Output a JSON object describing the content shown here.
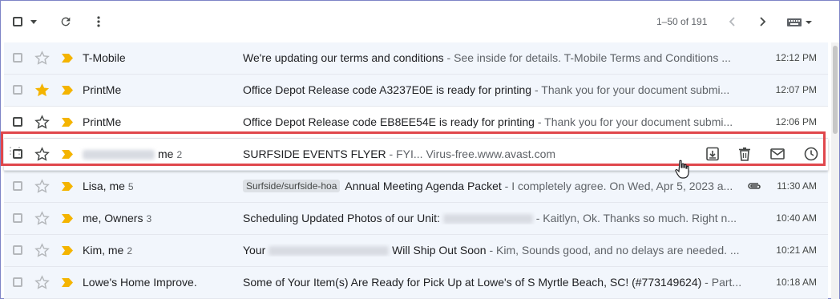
{
  "toolbar": {
    "pagination": "1–50 of 191",
    "icons": [
      "select-all-checkbox",
      "dropdown-caret",
      "refresh-icon",
      "more-vert-icon",
      "chevron-left-icon",
      "chevron-right-icon",
      "keyboard-icon"
    ]
  },
  "colors": {
    "important": "#f4b400",
    "star": "#f4b400",
    "highlight": "#e0474c"
  },
  "emails": [
    {
      "sender": "T-Mobile",
      "count": "",
      "label": "",
      "subject": "We're updating our terms and conditions",
      "snippet": " - See inside for details. T-Mobile Terms and Conditions ...",
      "time": "12:12 PM",
      "starred": false,
      "unread": false,
      "attachment": false
    },
    {
      "sender": "PrintMe",
      "count": "",
      "label": "",
      "subject": "Office Depot Release code A3237E0E is ready for printing",
      "snippet": " - Thank you for your document submi...",
      "time": "12:07 PM",
      "starred": true,
      "unread": false,
      "attachment": false
    },
    {
      "sender": "PrintMe",
      "count": "",
      "label": "",
      "subject": "Office Depot Release code EB8EE54E is ready for printing",
      "snippet": " - Thank you for your document submi...",
      "time": "12:06 PM",
      "starred": false,
      "unread": true,
      "attachment": false
    },
    {
      "sender": "me",
      "count": "2",
      "label": "",
      "subject": "SURFSIDE EVENTS FLYER",
      "snippet": " - FYI... Virus-free.www.avast.com",
      "time": "",
      "starred": false,
      "unread": true,
      "attachment": false,
      "hovered": true
    },
    {
      "sender": "Lisa, me",
      "count": "5",
      "label": "Surfside/surfside-hoa",
      "subject": "Annual Meeting Agenda Packet",
      "snippet": " - I completely agree. On Wed, Apr 5, 2023 a...",
      "time": "11:30 AM",
      "starred": false,
      "unread": false,
      "attachment": true
    },
    {
      "sender": "me, Owners",
      "count": "3",
      "label": "",
      "subject": "Scheduling Updated Photos of our Unit: ",
      "snippet": " - Kaitlyn, Ok. Thanks so much. Right n...",
      "time": "10:40 AM",
      "starred": false,
      "unread": false,
      "attachment": false
    },
    {
      "sender": "Kim, me",
      "count": "2",
      "label": "",
      "subject": "Your ",
      "subject2": " Will Ship Out Soon",
      "snippet": " - Kim, Sounds good, and no delays are needed. ...",
      "time": "10:21 AM",
      "starred": false,
      "unread": false,
      "attachment": false
    },
    {
      "sender": "Lowe's Home Improve.",
      "count": "",
      "label": "",
      "subject": "Some of Your Item(s) Are Ready for Pick Up at Lowe's of S Myrtle Beach, SC! (#773149624)",
      "snippet": " - Part...",
      "time": "10:18 AM",
      "starred": false,
      "unread": false,
      "attachment": false
    }
  ]
}
